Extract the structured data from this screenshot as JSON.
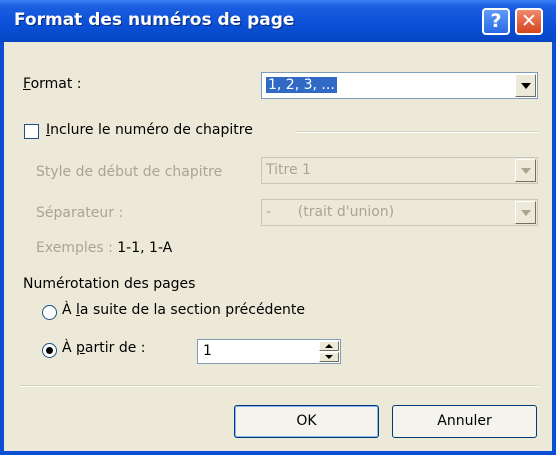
{
  "window": {
    "title": "Format des numéros de page",
    "help_glyph": "?",
    "close_glyph": "✕"
  },
  "format": {
    "label_key": "F",
    "label_rest": "ormat :",
    "value": "1, 2, 3, ..."
  },
  "chapter": {
    "checkbox_checked": false,
    "checkbox_label_key": "I",
    "checkbox_label_rest": "nclure le numéro de chapitre",
    "style_label": "Style de début de chapitre",
    "style_value": "Titre 1",
    "separator_label": "Séparateur :",
    "separator_value": "-      (trait d'union)",
    "examples_label": "Exemples :",
    "examples_value": "1-1, 1-A"
  },
  "numbering": {
    "section_label": "Numérotation des pages",
    "continue_label_a": "À ",
    "continue_label_key": "l",
    "continue_label_rest": "a suite de la section précédente",
    "continue_selected": false,
    "start_label_a": "À ",
    "start_label_key": "p",
    "start_label_rest": "artir de :",
    "start_selected": true,
    "start_value": "1"
  },
  "buttons": {
    "ok": "OK",
    "cancel": "Annuler"
  },
  "colors": {
    "titlebar": "#0a4fd6",
    "dialog_bg": "#ece9d8",
    "selection": "#316ac5"
  }
}
